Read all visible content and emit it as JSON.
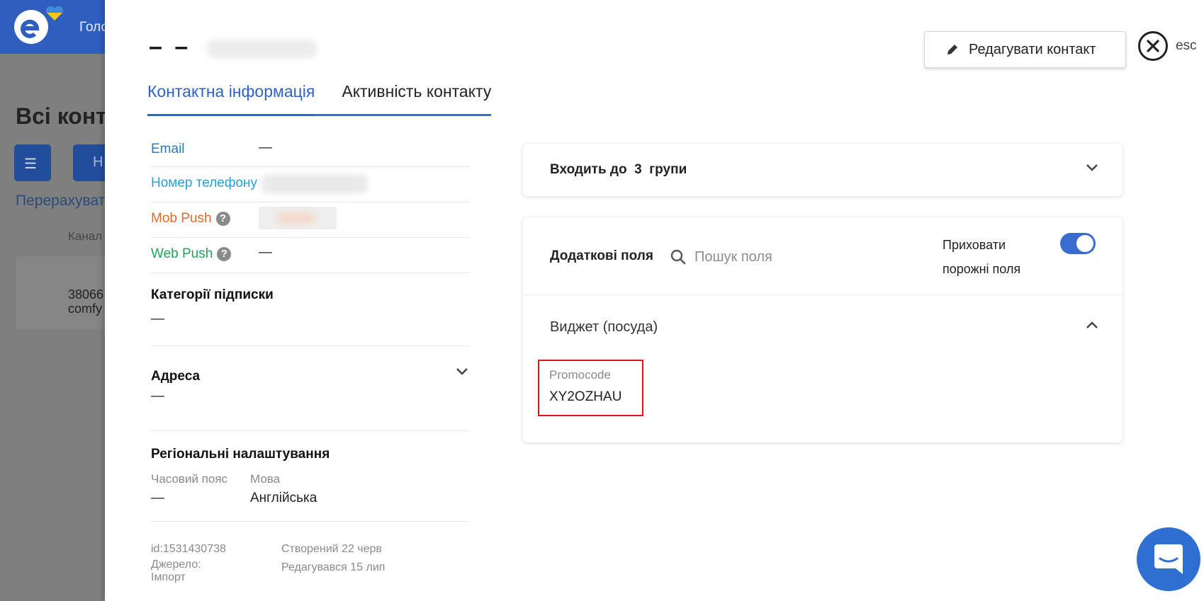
{
  "background": {
    "header_text": "Голо",
    "page_title": "Всі конта",
    "new_button": "Н",
    "recount_link": "Перерахуват",
    "channel_column": "Канал",
    "card_phone": "38066",
    "card_email": "comfy"
  },
  "contact": {
    "name": "– –",
    "tabs": [
      "Контактна інформація",
      "Активність контакту"
    ],
    "active_tab": "Контактна інформація",
    "edit_button": "Редагувати контакт",
    "close_hint": "esc"
  },
  "info": {
    "email_label": "Email",
    "email_value": "—",
    "phone_label": "Номер телефону",
    "mob_push_label": "Mob Push",
    "web_push_label": "Web Push",
    "web_push_value": "—",
    "subscription_title": "Категорії підписки",
    "subscription_value": "—",
    "address_title": "Адреса",
    "address_value": "—",
    "regional_title": "Регіональні налаштування",
    "timezone_label": "Часовий пояс",
    "timezone_value": "—",
    "language_label": "Мова",
    "language_value": "Англійська",
    "id": "id:1531430738",
    "source_label": "Джерело:",
    "source_value": "Імпорт",
    "created": "Створений 22 черв",
    "edited": "Редагувався 15 лип"
  },
  "groups": {
    "text": "Входить до  3  групи"
  },
  "fields": {
    "title": "Додаткові поля",
    "search_placeholder": "Пошук поля",
    "hide_empty_line1": "Приховати",
    "hide_empty_line2": "порожні поля",
    "hide_empty_enabled": true,
    "widget_title": "Виджет (посуда)",
    "promo_label": "Promocode",
    "promo_value": "XY2OZHAU"
  },
  "colors": {
    "accent": "#2f63c9",
    "email": "#1f7fc4",
    "phone": "#23a3d8",
    "mob_push": "#e06a2b",
    "web_push": "#20a55b",
    "highlight": "#e0141b"
  },
  "icons": [
    "pencil-icon",
    "close-icon",
    "help-icon",
    "chevron-down-icon",
    "chevron-up-icon",
    "search-icon",
    "chat-icon",
    "logo-icon",
    "heart-icon",
    "list-icon"
  ]
}
